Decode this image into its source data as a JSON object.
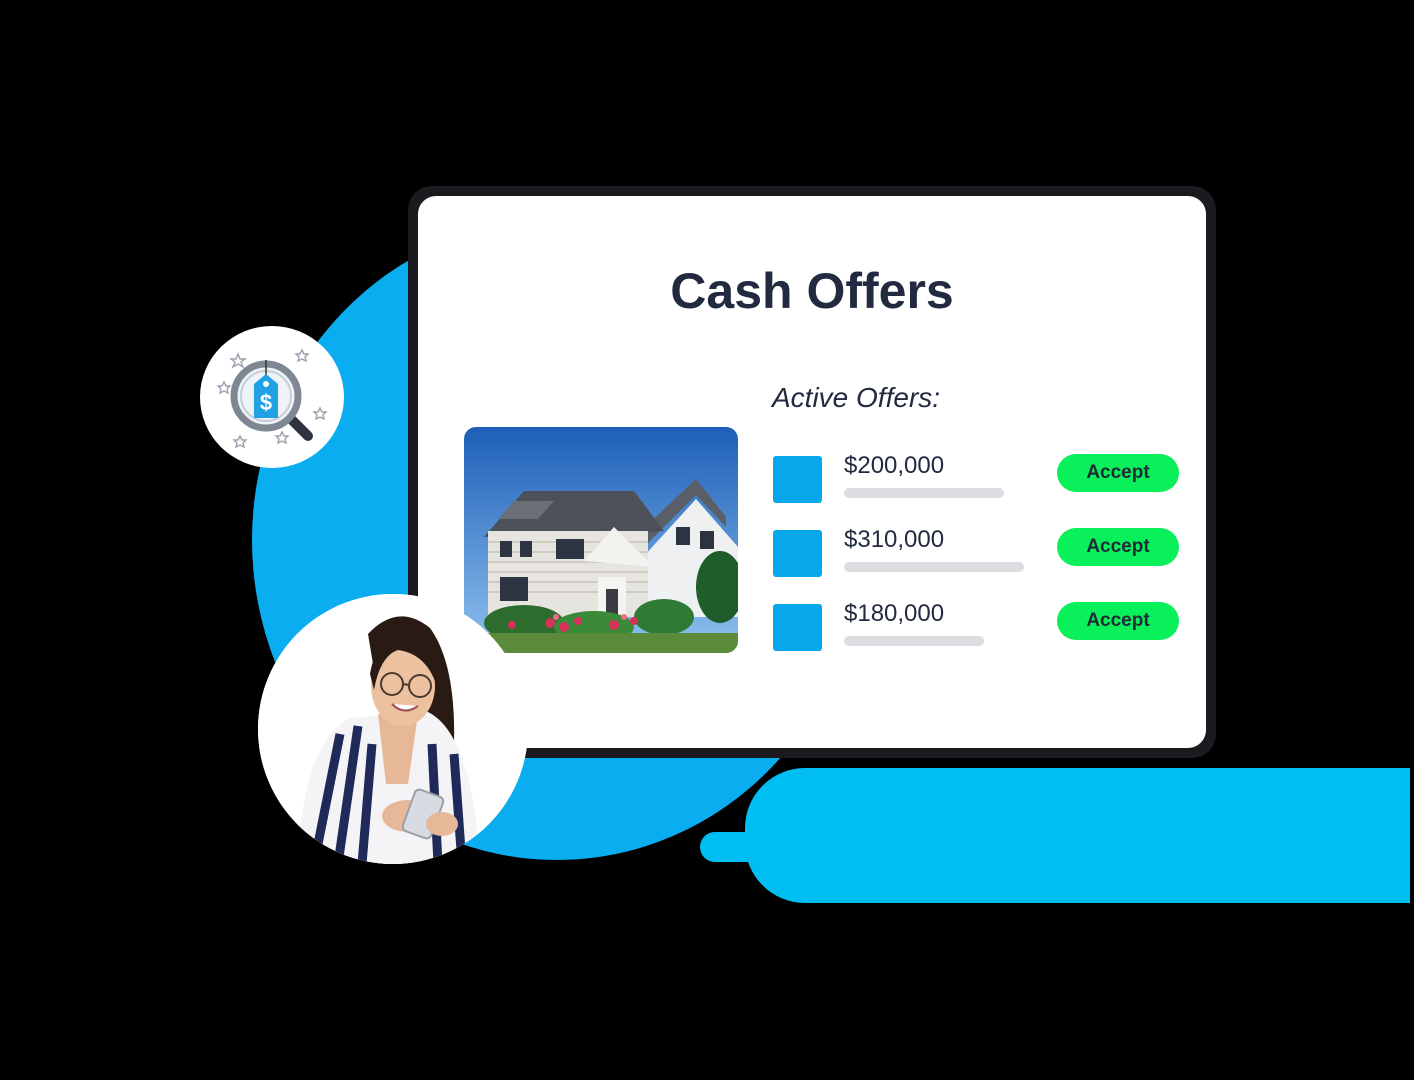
{
  "card": {
    "title": "Cash Offers",
    "active_offers_label": "Active Offers:",
    "offers": [
      {
        "amount": "$200,000",
        "accept_label": "Accept"
      },
      {
        "amount": "$310,000",
        "accept_label": "Accept"
      },
      {
        "amount": "$180,000",
        "accept_label": "Accept"
      }
    ]
  },
  "icons": {
    "badge": "magnifier-price-tag-icon",
    "badge_symbol": "$",
    "property": "house-photo",
    "person": "woman-with-phone-avatar"
  },
  "colors": {
    "accent_blue": "#0aaef0",
    "accept_green": "#0af05a",
    "title_navy": "#222a40",
    "offer_square": "#08a6ea"
  }
}
